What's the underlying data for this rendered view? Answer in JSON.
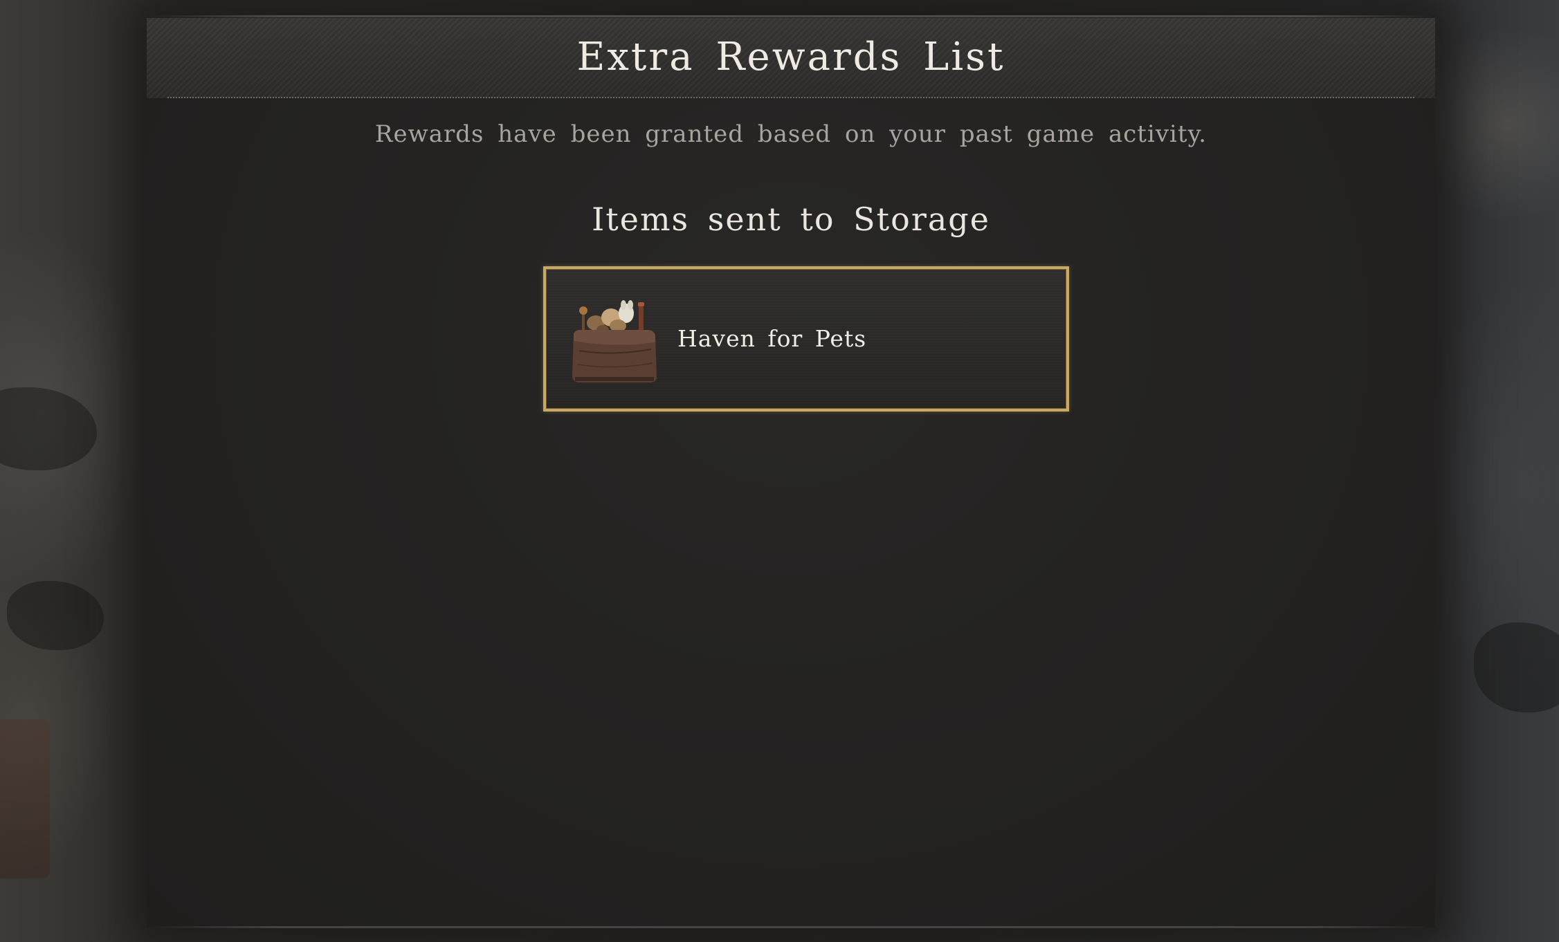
{
  "dialog": {
    "title": "Extra Rewards List",
    "subtitle": "Rewards have been granted based on your past game activity.",
    "section_heading": "Items sent to Storage"
  },
  "rewards": [
    {
      "label": "Haven for Pets",
      "icon": "pet-toy-bag-icon"
    }
  ],
  "colors": {
    "panel_bg": "#242322",
    "title_text": "#efebe3",
    "subtitle_text": "#a9a59e",
    "card_border_gold": "#c9a964"
  }
}
